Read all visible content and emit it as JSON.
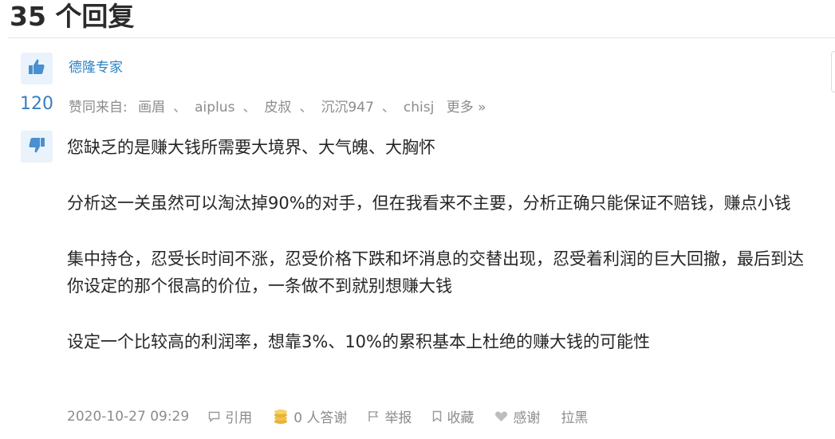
{
  "header": {
    "title": "35 个回复"
  },
  "answer": {
    "author": "德隆专家",
    "vote_count": "120",
    "upvoters": {
      "prefix": "赞同来自:",
      "names": [
        "画眉",
        "aiplus",
        "皮叔",
        "沉沉947",
        "chisj"
      ],
      "separator": "、",
      "more_label": "更多 »"
    },
    "paragraphs": [
      "您缺乏的是赚大钱所需要大境界、大气魄、大胸怀",
      "分析这一关虽然可以淘汰掉90%的对手，但在我看来不主要，分析正确只能保证不赔钱，赚点小钱",
      "集中持仓，忍受长时间不涨，忍受价格下跌和坏消息的交替出现，忍受着利润的巨大回撤，最后到达你设定的那个很高的价位，一条做不到就别想赚大钱",
      "设定一个比较高的利润率，想靠3%、10%的累积基本上杜绝的赚大钱的可能性"
    ],
    "meta": {
      "timestamp": "2020-10-27 09:29",
      "quote_label": "引用",
      "thanks_label": "0 人答谢",
      "report_label": "举报",
      "favorite_label": "收藏",
      "thank_label": "感谢",
      "block_label": "拉黑"
    }
  },
  "icons": {
    "upvote": "thumbs-up-icon",
    "downvote": "thumbs-down-icon",
    "quote": "comment-icon",
    "coins": "coins-icon",
    "report": "flag-icon",
    "favorite": "bookmark-icon",
    "thank": "heart-icon"
  },
  "colors": {
    "accent": "#2a82c4",
    "vote_bg": "#eaf3fb",
    "muted": "#8c8c8c",
    "coin": "#e8b23a"
  }
}
